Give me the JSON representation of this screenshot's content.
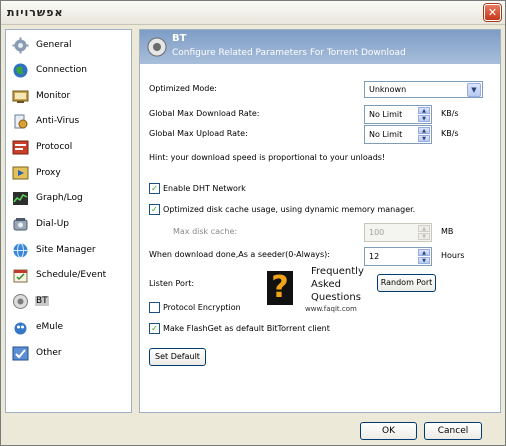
{
  "window": {
    "title": "אפשרויות",
    "close_symbol": "✕"
  },
  "sidebar": {
    "items": [
      {
        "label": "General",
        "icon": "general-icon"
      },
      {
        "label": "Connection",
        "icon": "connection-icon"
      },
      {
        "label": "Monitor",
        "icon": "monitor-icon"
      },
      {
        "label": "Anti-Virus",
        "icon": "antivirus-icon"
      },
      {
        "label": "Protocol",
        "icon": "protocol-icon"
      },
      {
        "label": "Proxy",
        "icon": "proxy-icon"
      },
      {
        "label": "Graph/Log",
        "icon": "graph-icon"
      },
      {
        "label": "Dial-Up",
        "icon": "dialup-icon"
      },
      {
        "label": "Site Manager",
        "icon": "site-manager-icon"
      },
      {
        "label": "Schedule/Event",
        "icon": "schedule-icon"
      },
      {
        "label": "BT",
        "icon": "bt-icon",
        "selected": true
      },
      {
        "label": "eMule",
        "icon": "emule-icon"
      },
      {
        "label": "Other",
        "icon": "other-icon"
      }
    ]
  },
  "banner": {
    "title": "BT",
    "subtitle": "Configure Related Parameters For Torrent Download"
  },
  "settings": {
    "optimized_mode_label": "Optimized Mode:",
    "optimized_mode_value": "Unknown",
    "dl_rate_label": "Global Max Download Rate:",
    "dl_rate_value": "No Limit",
    "dl_rate_unit": "KB/s",
    "ul_rate_label": "Global Max Upload Rate:",
    "ul_rate_value": "No Limit",
    "ul_rate_unit": "KB/s",
    "hint": "Hint: your download speed is proportional to your unloads!",
    "dht_label": "Enable DHT Network",
    "dht_checked": true,
    "disk_cache_label": "Optimized disk cache usage, using dynamic memory manager.",
    "disk_cache_checked": true,
    "max_cache_label": "Max disk cache:",
    "max_cache_value": "100",
    "max_cache_unit": "MB",
    "seeder_label": "When download done,As a seeder(0-Always):",
    "seeder_value": "12",
    "seeder_unit": "Hours",
    "listen_port_label": "Listen Port:",
    "random_port_label": "Random Port",
    "protocol_enc_label": "Protocol Encryption",
    "protocol_enc_checked": false,
    "default_client_label": "Make FlashGet as default BitTorrent client",
    "default_client_checked": true,
    "set_default_label": "Set Default"
  },
  "watermark": {
    "line1": "Frequently",
    "line2": "Asked",
    "line3": "Questions",
    "url": "www.faqit.com",
    "mark": "?"
  },
  "footer": {
    "ok_label": "OK",
    "cancel_label": "Cancel"
  },
  "colors": {
    "banner": "#7e9dc6",
    "check": "#21a121",
    "selection": "#c9c9c9"
  }
}
